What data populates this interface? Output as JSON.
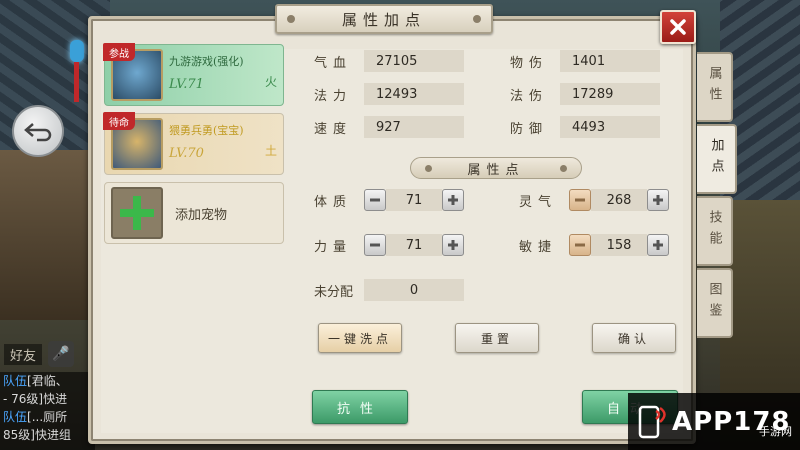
{
  "window": {
    "title": "属性加点"
  },
  "side_tabs": [
    {
      "label": "属性",
      "active": false
    },
    {
      "label": "加点",
      "active": true
    },
    {
      "label": "技能",
      "active": false
    },
    {
      "label": "图鉴",
      "active": false
    }
  ],
  "pets": [
    {
      "badge": "参战",
      "name": "九游游戏(强化)",
      "level": "LV.71",
      "status": "火",
      "selected": true
    },
    {
      "badge": "待命",
      "name": "猥勇兵勇(宝宝)",
      "level": "LV.70",
      "status": "土",
      "selected": false
    }
  ],
  "add_pet": {
    "label": "添加宠物"
  },
  "stats": {
    "hp": {
      "label": "气血",
      "value": "27105"
    },
    "phys_dmg": {
      "label": "物伤",
      "value": "1401"
    },
    "mp": {
      "label": "法力",
      "value": "12493"
    },
    "magic_dmg": {
      "label": "法伤",
      "value": "17289"
    },
    "speed": {
      "label": "速度",
      "value": "927"
    },
    "defense": {
      "label": "防御",
      "value": "4493"
    }
  },
  "allocation": {
    "section_title": "属性点",
    "constitution": {
      "label": "体质",
      "value": "71"
    },
    "spirit": {
      "label": "灵气",
      "value": "268"
    },
    "strength": {
      "label": "力量",
      "value": "71"
    },
    "agility": {
      "label": "敏捷",
      "value": "158"
    },
    "unallocated": {
      "label": "未分配",
      "value": "0"
    }
  },
  "buttons": {
    "one_click": "一键洗点",
    "reset": "重置",
    "confirm": "确认",
    "resist": "抗性",
    "auto": "自动"
  },
  "hud": {
    "friend": "好友",
    "chat_lines": [
      {
        "tag": "队伍",
        "text": "[君临、"
      },
      {
        "tag": "",
        "text": "- 76级]快进"
      },
      {
        "tag": "队伍",
        "text": "[...厕所"
      },
      {
        "tag": "",
        "text": "85级]快进组"
      }
    ]
  },
  "watermark": {
    "text": "APP178",
    "sub": "手游网"
  },
  "colors": {
    "accent_green": "#3c9a68",
    "close_red": "#c0282a",
    "panel": "#e9e4d8"
  }
}
